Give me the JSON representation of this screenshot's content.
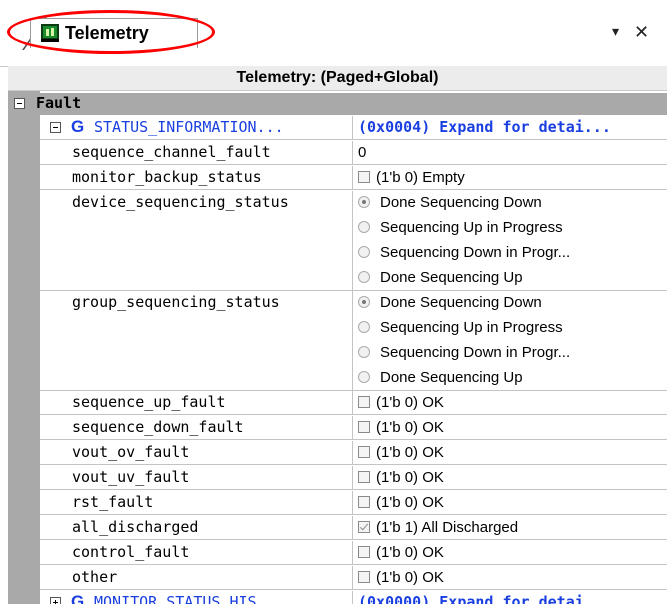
{
  "tab": {
    "label": "Telemetry"
  },
  "controls": {
    "dropdown": "▾",
    "close": "✕"
  },
  "grid_title": "Telemetry: (Paged+Global)",
  "group": {
    "label": "Fault"
  },
  "status_info": {
    "label": "STATUS_INFORMATION...",
    "value": "(0x0004) Expand for detai..."
  },
  "rows": {
    "sequence_channel_fault": {
      "name": "sequence_channel_fault",
      "value": "0"
    },
    "monitor_backup_status": {
      "name": "monitor_backup_status",
      "value": "(1'b 0) Empty"
    },
    "device_sequencing_status": {
      "name": "device_sequencing_status",
      "options": [
        "Done Sequencing Down",
        "Sequencing Up in Progress",
        "Sequencing Down in Progr...",
        "Done Sequencing Up"
      ]
    },
    "group_sequencing_status": {
      "name": "group_sequencing_status",
      "options": [
        "Done Sequencing Down",
        "Sequencing Up in Progress",
        "Sequencing Down in Progr...",
        "Done Sequencing Up"
      ]
    },
    "sequence_up_fault": {
      "name": "sequence_up_fault",
      "value": "(1'b 0) OK"
    },
    "sequence_down_fault": {
      "name": "sequence_down_fault",
      "value": "(1'b 0) OK"
    },
    "vout_ov_fault": {
      "name": "vout_ov_fault",
      "value": "(1'b 0) OK"
    },
    "vout_uv_fault": {
      "name": "vout_uv_fault",
      "value": "(1'b 0) OK"
    },
    "rst_fault": {
      "name": "rst_fault",
      "value": "(1'b 0) OK"
    },
    "all_discharged": {
      "name": "all_discharged",
      "value": "(1'b 1) All Discharged"
    },
    "control_fault": {
      "name": "control_fault",
      "value": "(1'b 0) OK"
    },
    "other": {
      "name": "other",
      "value": "(1'b 0) OK"
    }
  },
  "monitor_status": {
    "label": "MONITOR_STATUS_HIS...",
    "value": "(0x0000) Expand for detai..."
  },
  "colors": {
    "link_blue": "#1a3fe0",
    "highlight_oval": "#ff0000",
    "strip_gray": "#a9a9a9"
  },
  "icons": [
    "telemetry-app-icon",
    "g-register-icon",
    "checkbox-icon",
    "radio-icon",
    "collapse-icon",
    "expand-icon"
  ]
}
